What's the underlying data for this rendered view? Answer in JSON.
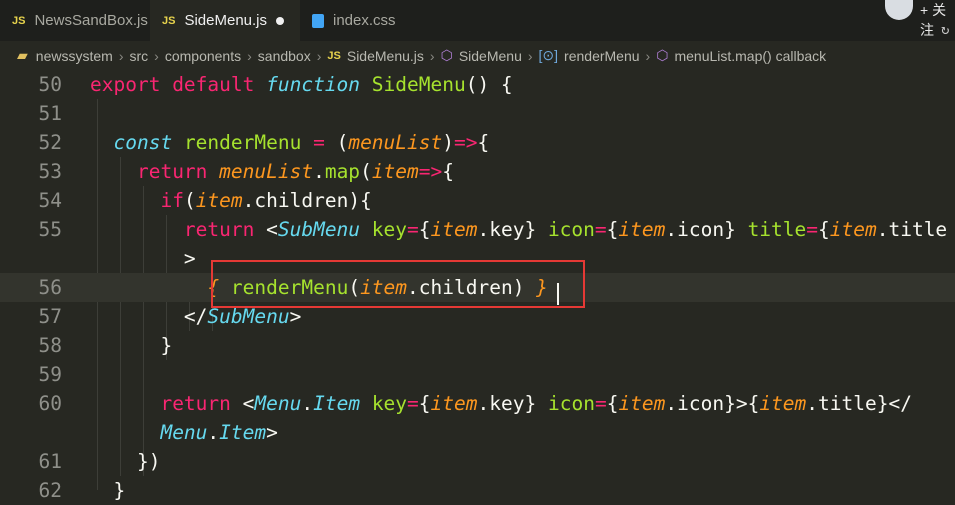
{
  "tabs": [
    {
      "icon": "JS",
      "label": "NewsSandBox.js"
    },
    {
      "icon": "JS",
      "label": "SideMenu.js"
    },
    {
      "icon": "css-icon",
      "label": "index.css"
    }
  ],
  "topright": {
    "follow_label": "+ 关注"
  },
  "breadcrumb": {
    "items": [
      "newssystem",
      "src",
      "components",
      "sandbox"
    ],
    "file_icon": "JS",
    "file": "SideMenu.js",
    "symbol1": "SideMenu",
    "symbol2": "renderMenu",
    "symbol3": "menuList.map() callback"
  },
  "lines": [
    {
      "n": "50",
      "tokens": [
        [
          "k",
          "export "
        ],
        [
          "k",
          "default "
        ],
        [
          "t",
          "function "
        ],
        [
          "f",
          "SideMenu"
        ],
        [
          "w",
          "() {"
        ]
      ]
    },
    {
      "n": "51",
      "tokens": []
    },
    {
      "n": "52",
      "tokens": [
        [
          "w",
          "  "
        ],
        [
          "t",
          "const "
        ],
        [
          "f",
          "renderMenu"
        ],
        [
          "k",
          " = "
        ],
        [
          "w",
          "("
        ],
        [
          "v",
          "menuList"
        ],
        [
          "w",
          ")"
        ],
        [
          "k",
          "=>"
        ],
        [
          "w",
          "{"
        ]
      ]
    },
    {
      "n": "53",
      "tokens": [
        [
          "w",
          "    "
        ],
        [
          "k",
          "return "
        ],
        [
          "v",
          "menuList"
        ],
        [
          "w",
          "."
        ],
        [
          "f",
          "map"
        ],
        [
          "w",
          "("
        ],
        [
          "v",
          "item"
        ],
        [
          "k",
          "=>"
        ],
        [
          "w",
          "{"
        ]
      ]
    },
    {
      "n": "54",
      "tokens": [
        [
          "w",
          "      "
        ],
        [
          "k",
          "if"
        ],
        [
          "w",
          "("
        ],
        [
          "v",
          "item"
        ],
        [
          "w",
          ".children){"
        ]
      ]
    },
    {
      "n": "55",
      "tokens": [
        [
          "w",
          "        "
        ],
        [
          "k",
          "return "
        ],
        [
          "w",
          "<"
        ],
        [
          "t",
          "SubMenu "
        ],
        [
          "f",
          "key"
        ],
        [
          "k",
          "="
        ],
        [
          "w",
          "{"
        ],
        [
          "v",
          "item"
        ],
        [
          "w",
          ".key} "
        ],
        [
          "f",
          "icon"
        ],
        [
          "k",
          "="
        ],
        [
          "w",
          "{"
        ],
        [
          "v",
          "item"
        ],
        [
          "w",
          ".icon} "
        ],
        [
          "f",
          "title"
        ],
        [
          "k",
          "="
        ],
        [
          "w",
          "{"
        ],
        [
          "v",
          "item"
        ],
        [
          "w",
          ".title"
        ]
      ]
    },
    {
      "n": "",
      "tokens": [
        [
          "w",
          "        >"
        ]
      ]
    },
    {
      "n": "56",
      "tokens": [
        [
          "w",
          "          "
        ],
        [
          "v",
          "{"
        ],
        [
          "w",
          " "
        ],
        [
          "f",
          "renderMenu"
        ],
        [
          "w",
          "("
        ],
        [
          "v",
          "item"
        ],
        [
          "w",
          ".children) "
        ],
        [
          "v",
          "}"
        ]
      ]
    },
    {
      "n": "57",
      "tokens": [
        [
          "w",
          "        </"
        ],
        [
          "t",
          "SubMenu"
        ],
        [
          "w",
          ">"
        ]
      ]
    },
    {
      "n": "58",
      "tokens": [
        [
          "w",
          "      }"
        ]
      ]
    },
    {
      "n": "59",
      "tokens": []
    },
    {
      "n": "60",
      "tokens": [
        [
          "w",
          "      "
        ],
        [
          "k",
          "return "
        ],
        [
          "w",
          "<"
        ],
        [
          "t",
          "Menu"
        ],
        [
          "w",
          "."
        ],
        [
          "t",
          "Item "
        ],
        [
          "f",
          "key"
        ],
        [
          "k",
          "="
        ],
        [
          "w",
          "{"
        ],
        [
          "v",
          "item"
        ],
        [
          "w",
          ".key} "
        ],
        [
          "f",
          "icon"
        ],
        [
          "k",
          "="
        ],
        [
          "w",
          "{"
        ],
        [
          "v",
          "item"
        ],
        [
          "w",
          ".icon}>{"
        ],
        [
          "v",
          "item"
        ],
        [
          "w",
          ".title}</"
        ]
      ]
    },
    {
      "n": "",
      "tokens": [
        [
          "w",
          "      "
        ],
        [
          "t",
          "Menu"
        ],
        [
          "w",
          "."
        ],
        [
          "t",
          "Item"
        ],
        [
          "w",
          ">"
        ]
      ]
    },
    {
      "n": "61",
      "tokens": [
        [
          "w",
          "    })"
        ]
      ]
    },
    {
      "n": "62",
      "tokens": [
        [
          "w",
          "  }"
        ]
      ]
    }
  ],
  "colors": {
    "accent_box": "#e53935",
    "background": "#272822"
  }
}
